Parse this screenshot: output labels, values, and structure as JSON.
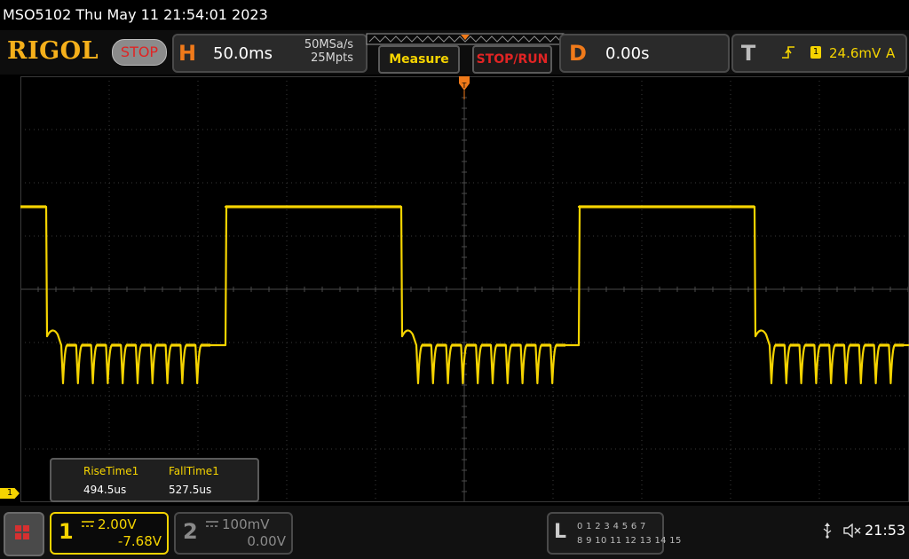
{
  "title_bar": {
    "text": "MSO5102  Thu May 11 21:54:01 2023"
  },
  "header": {
    "logo": "RIGOL",
    "run_state": "STOP",
    "horizontal": {
      "letter": "H",
      "timebase": "50.0ms",
      "sample_rate": "50MSa/s",
      "memory_depth": "25Mpts"
    },
    "measure_label": "Measure",
    "stop_run_label": "STOP/RUN",
    "delay": {
      "letter": "D",
      "value": "0.00s"
    },
    "trigger": {
      "letter": "T",
      "source": "1",
      "level": "24.6mV",
      "mode": "A"
    }
  },
  "measurements": [
    {
      "label": "RiseTime1",
      "value": "494.5us"
    },
    {
      "label": "FallTime1",
      "value": "527.5us"
    }
  ],
  "channel_marker": "1",
  "channels": [
    {
      "number": "1",
      "scale": "2.00V",
      "offset": "-7.68V",
      "color": "#f5d400",
      "active": true
    },
    {
      "number": "2",
      "scale": "100mV",
      "offset": "0.00V",
      "color": "#8a8a8a",
      "active": false
    }
  ],
  "logic_analyzer": {
    "letter": "L",
    "row1": "0 1 2 3  4 5 6 7",
    "row2": "8 9 10 11 12 13 14 15"
  },
  "status": {
    "usb_icon": "usb-icon",
    "sound_icon": "speaker-muted-icon",
    "time": "21:53"
  },
  "colors": {
    "trace": "#f5d400",
    "accent": "#f07a1a",
    "grid": "#3a3a3a"
  }
}
